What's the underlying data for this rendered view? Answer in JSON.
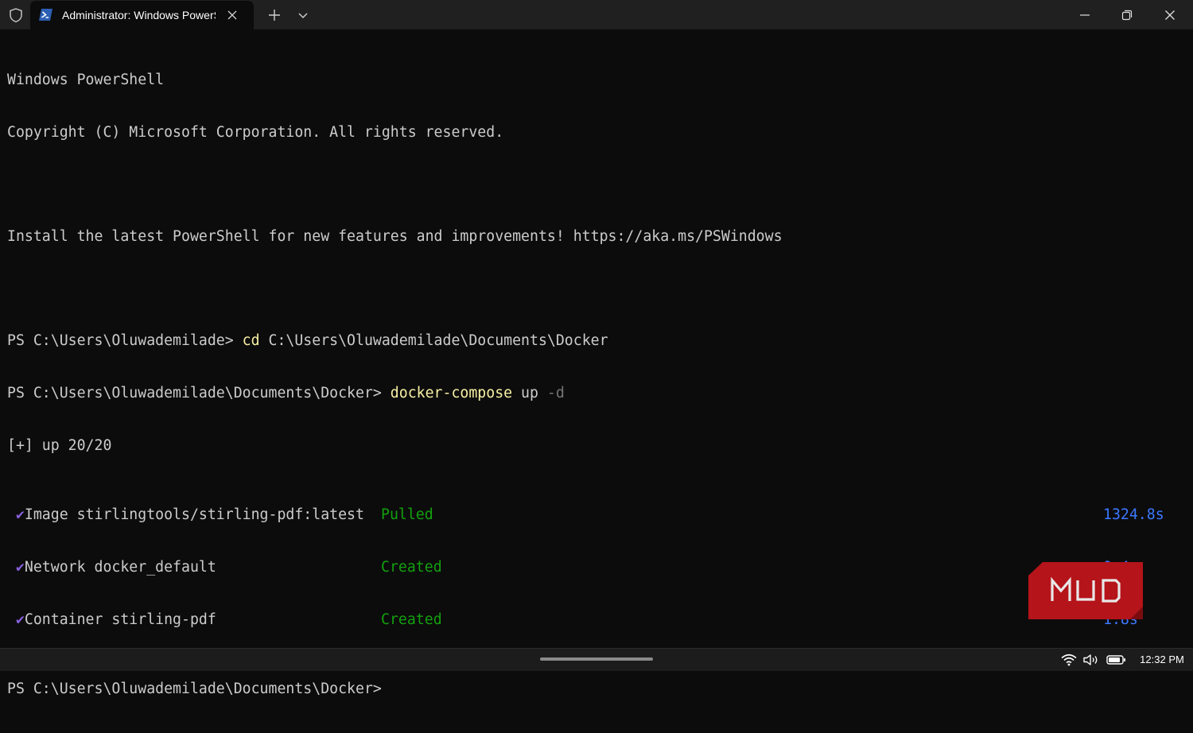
{
  "window": {
    "tab_title": "Administrator: Windows PowerShell",
    "icons": {
      "shield": "shield-icon",
      "tab": "powershell-icon",
      "tab_close": "close-icon",
      "new_tab": "plus-icon",
      "dropdown": "chevron-down-icon",
      "minimize": "minimize-icon",
      "restore": "restore-icon",
      "close": "close-icon"
    }
  },
  "terminal": {
    "header": {
      "line1": "Windows PowerShell",
      "line2": "Copyright (C) Microsoft Corporation. All rights reserved.",
      "line3": "Install the latest PowerShell for new features and improvements! https://aka.ms/PSWindows"
    },
    "cmd1": {
      "prompt": "PS C:\\Users\\Oluwademilade> ",
      "command": "cd",
      "args": " C:\\Users\\Oluwademilade\\Documents\\Docker"
    },
    "cmd2": {
      "prompt": "PS C:\\Users\\Oluwademilade\\Documents\\Docker> ",
      "command": "docker-compose",
      "args": " up ",
      "flag": "-d"
    },
    "progress": "[+] up 20/20",
    "items": [
      {
        "label": "Image stirlingtools/stirling-pdf:latest",
        "status": "Pulled",
        "time": "1324.8s"
      },
      {
        "label": "Network docker_default",
        "status": "Created",
        "time": "0.4s"
      },
      {
        "label": "Container stirling-pdf",
        "status": "Created",
        "time": "1.8s"
      }
    ],
    "final_prompt": "PS C:\\Users\\Oluwademilade\\Documents\\Docker>"
  },
  "watermark": {
    "text": "MUO",
    "color": "#b5141a"
  },
  "taskbar": {
    "clock": "12:32 PM",
    "icons": [
      "wifi-icon",
      "volume-icon",
      "battery-icon"
    ]
  },
  "colors": {
    "terminal_bg": "#0c0c0c",
    "terminal_text": "#cccccc",
    "command": "#f9f1a5",
    "success": "#13a10e",
    "timing": "#3b78ff",
    "checkmark": "#8a5fe0",
    "titlebar": "#202020"
  }
}
